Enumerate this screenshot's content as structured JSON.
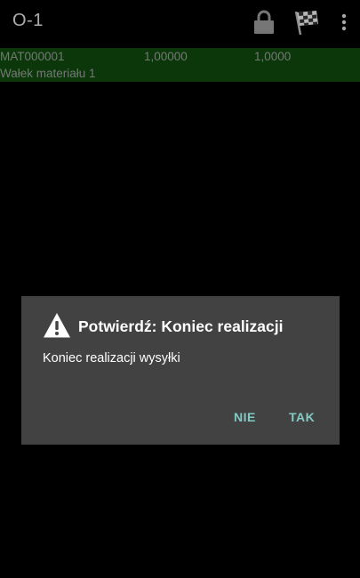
{
  "appbar": {
    "title": "O-1",
    "icons": [
      "lock-icon",
      "checkered-flag-icon",
      "overflow-menu-icon"
    ]
  },
  "list": {
    "items": [
      {
        "code": "MAT000001",
        "qty_ordered": "1,00000",
        "qty_done": "1,0000",
        "name": "Wałek materiału 1",
        "highlight_color": "#0f4a0f"
      }
    ]
  },
  "dialog": {
    "icon": "warning-icon",
    "title": "Potwierdź: Koniec realizacji",
    "message": "Koniec realizacji wysyłki",
    "negative_label": "NIE",
    "positive_label": "TAK",
    "accent_color": "#80cbc4"
  }
}
